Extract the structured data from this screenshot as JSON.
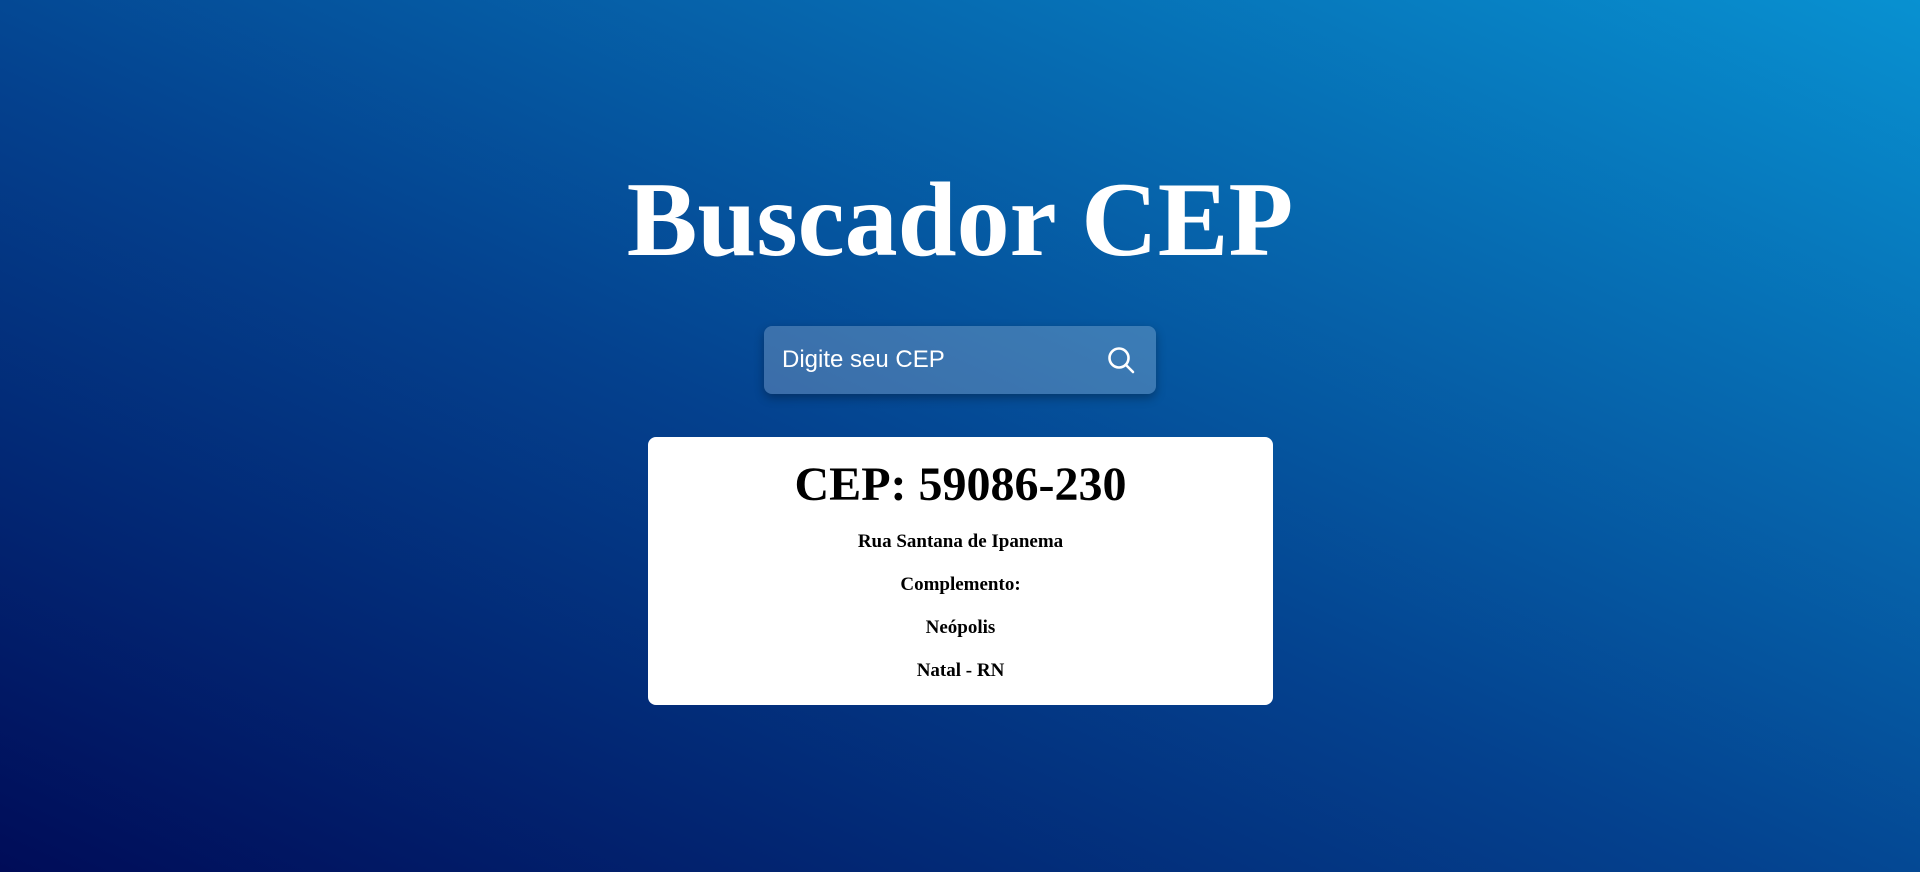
{
  "header": {
    "title": "Buscador CEP"
  },
  "search": {
    "placeholder": "Digite seu CEP",
    "value": "",
    "icon": "search-icon"
  },
  "result": {
    "cep_heading": "CEP: 59086-230",
    "street": "Rua Santana de Ipanema",
    "complement": "Complemento:",
    "neighborhood": "Neópolis",
    "city_state": "Natal - RN"
  },
  "colors": {
    "gradient_dark": "#000c58",
    "gradient_mid": "#04418e",
    "gradient_light": "#0891d1",
    "card_bg": "#ffffff",
    "title_text": "#ffffff"
  }
}
